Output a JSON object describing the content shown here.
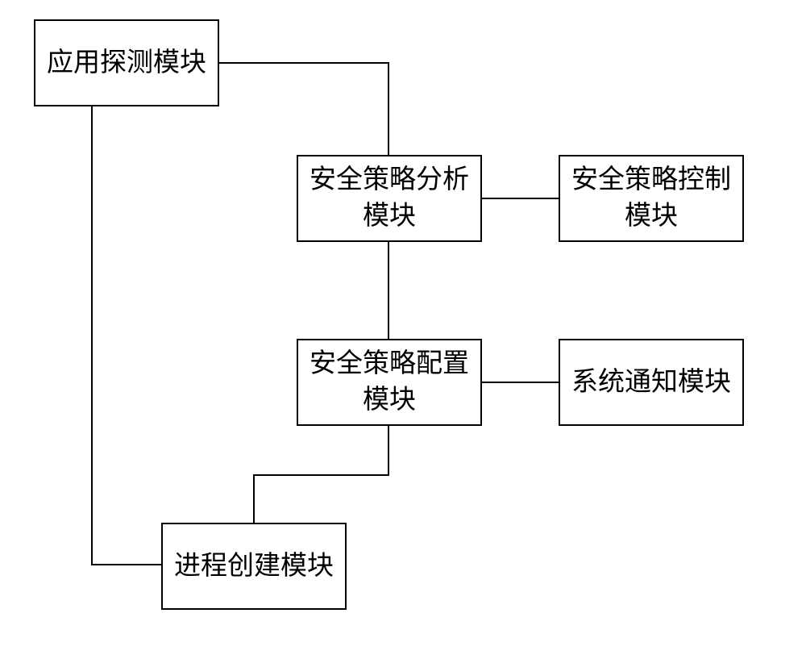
{
  "diagram": {
    "nodes": {
      "app_detect": {
        "label": "应用探测模块"
      },
      "policy_analysis": {
        "label": "安全策略分析模块"
      },
      "policy_control": {
        "label": "安全策略控制模块"
      },
      "policy_config": {
        "label": "安全策略配置模块"
      },
      "system_notify": {
        "label": "系统通知模块"
      },
      "process_create": {
        "label": "进程创建模块"
      }
    },
    "edges": [
      [
        "app_detect",
        "policy_analysis"
      ],
      [
        "policy_analysis",
        "policy_control"
      ],
      [
        "policy_analysis",
        "policy_config"
      ],
      [
        "policy_config",
        "system_notify"
      ],
      [
        "policy_config",
        "process_create"
      ],
      [
        "app_detect",
        "process_create"
      ]
    ]
  }
}
